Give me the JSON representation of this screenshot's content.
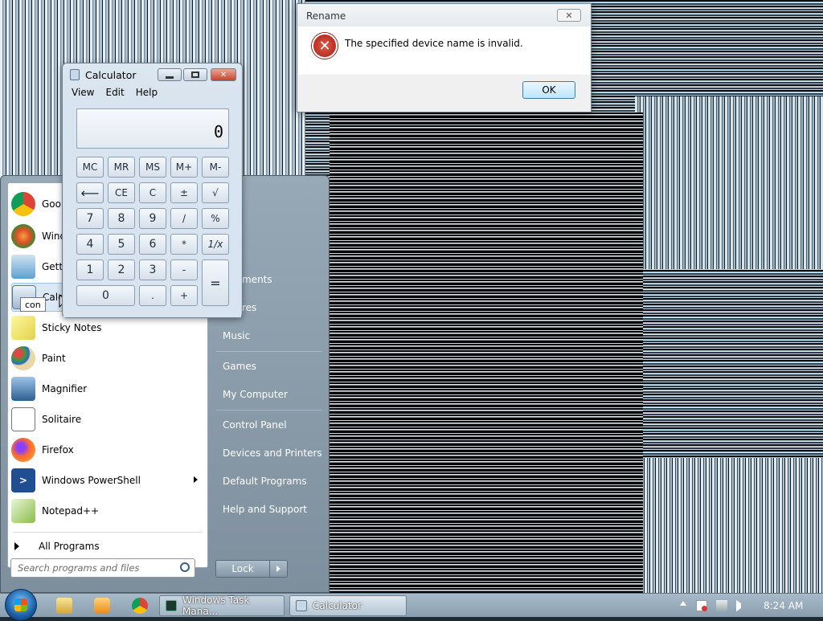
{
  "dialog": {
    "title": "Rename",
    "message": "The specified device name is invalid.",
    "ok_label": "OK",
    "close_glyph": "✕"
  },
  "calculator": {
    "title": "Calculator",
    "menu": [
      "View",
      "Edit",
      "Help"
    ],
    "display": "0",
    "buttons": {
      "mc": "MC",
      "mr": "MR",
      "ms": "MS",
      "mplus": "M+",
      "mminus": "M-",
      "back": "⟵",
      "ce": "CE",
      "c": "C",
      "pm": "±",
      "sqrt": "√",
      "n7": "7",
      "n8": "8",
      "n9": "9",
      "div": "/",
      "pct": "%",
      "n4": "4",
      "n5": "5",
      "n6": "6",
      "mul": "*",
      "inv": "1/x",
      "n1": "1",
      "n2": "2",
      "n3": "3",
      "sub": "-",
      "eq": "=",
      "n0": "0",
      "dot": ".",
      "add": "+"
    }
  },
  "start_menu": {
    "left_items": [
      {
        "label": "Goo",
        "icon": "chrome-icon"
      },
      {
        "label": "Wind",
        "icon": "windows-media-icon"
      },
      {
        "label": "Getti",
        "icon": "getting-started-icon"
      },
      {
        "label": "Calc",
        "icon": "calculator-icon"
      },
      {
        "label": "Sticky Notes",
        "icon": "sticky-notes-icon"
      },
      {
        "label": "Paint",
        "icon": "paint-icon"
      },
      {
        "label": "Magnifier",
        "icon": "magnifier-icon"
      },
      {
        "label": "Solitaire",
        "icon": "solitaire-icon"
      },
      {
        "label": "Firefox",
        "icon": "firefox-icon"
      },
      {
        "label": "Windows PowerShell",
        "icon": "powershell-icon"
      },
      {
        "label": "Notepad++",
        "icon": "notepadpp-icon"
      }
    ],
    "all_programs": "All Programs",
    "search_placeholder": "Search programs and files",
    "tooltip": "con",
    "right_items": [
      "ments",
      "res",
      "Music",
      "Games",
      "My Computer",
      "Control Panel",
      "Devices and Printers",
      "Default Programs",
      "Help and Support"
    ],
    "lock_label": "Lock"
  },
  "taskbar": {
    "task_manager": "Windows Task Mana...",
    "calculator": "Calculator",
    "clock": "8:24 AM"
  }
}
